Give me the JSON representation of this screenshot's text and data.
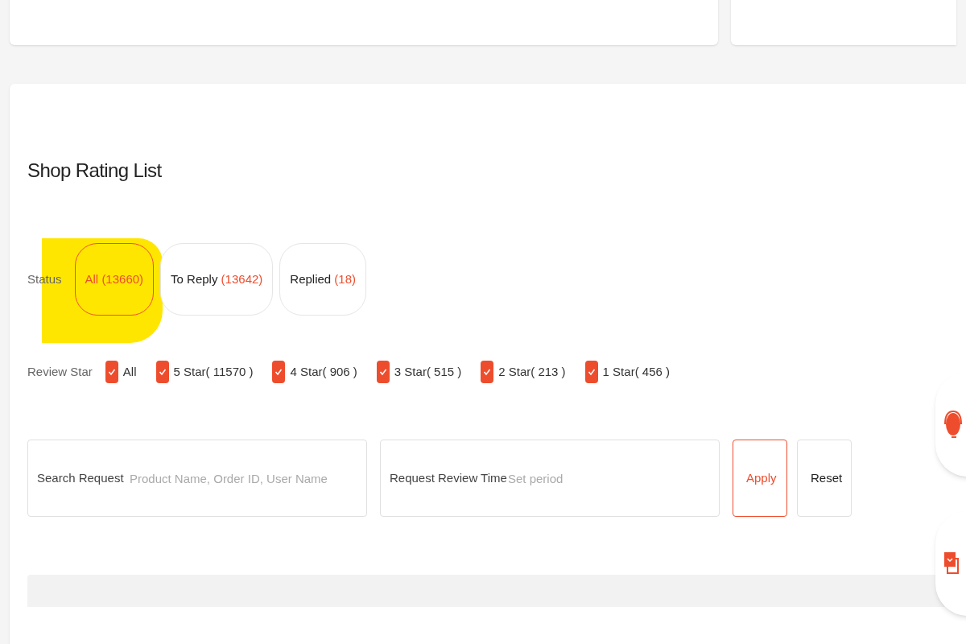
{
  "section": {
    "title": "Shop Rating List"
  },
  "status": {
    "label": "Status",
    "options": [
      {
        "label": "All",
        "count": "(13660)",
        "selected": true
      },
      {
        "label": "To Reply",
        "count": "(13642)",
        "selected": false
      },
      {
        "label": "Replied",
        "count": "(18)",
        "selected": false
      }
    ]
  },
  "review_star": {
    "label": "Review Star",
    "options": [
      {
        "label": "All",
        "checked": true
      },
      {
        "label": "5 Star( 11570 )",
        "checked": true
      },
      {
        "label": "4 Star( 906 )",
        "checked": true
      },
      {
        "label": "3 Star( 515 )",
        "checked": true
      },
      {
        "label": "2 Star( 213 )",
        "checked": true
      },
      {
        "label": "1 Star( 456 )",
        "checked": true
      }
    ]
  },
  "search": {
    "label": "Search Request",
    "placeholder": "Product Name, Order ID, User Name"
  },
  "review_time": {
    "label": "Request Review Time",
    "placeholder": "Set period"
  },
  "buttons": [
    {
      "label": "Apply",
      "kind": "primary"
    },
    {
      "label": "Reset",
      "kind": "secondary"
    }
  ]
}
